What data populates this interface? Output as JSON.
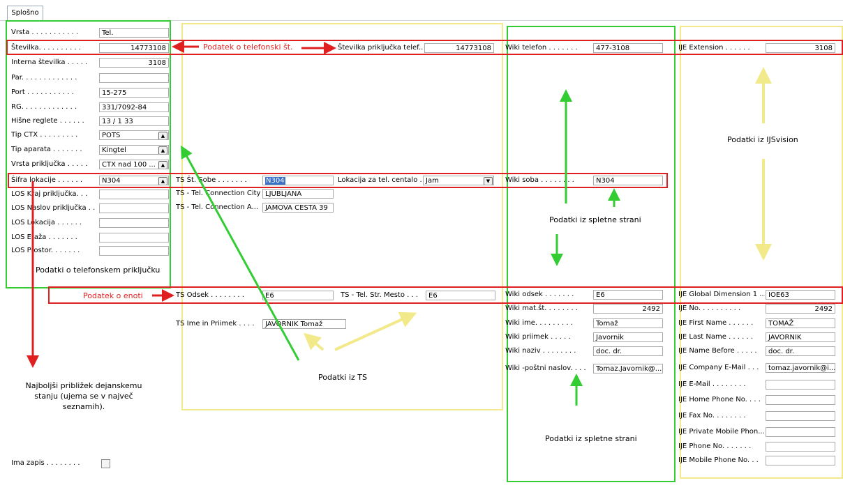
{
  "tabs": [
    {
      "label": "Splošno"
    }
  ],
  "col1": [
    {
      "label": "Vrsta . . . . . . . . . . .",
      "value": "Tel."
    },
    {
      "label": "Številka. . . . . . . . . .",
      "value": "14773108"
    },
    {
      "label": "Interna številka . . . . .",
      "value": "3108"
    },
    {
      "label": "Par. . . . . . . . . . . . .",
      "value": ""
    },
    {
      "label": "Port . . . . . . . . . . .",
      "value": "15-275"
    },
    {
      "label": "RG. . . . . . . . . . . . .",
      "value": "331/7092-84"
    },
    {
      "label": "Hišne reglete . . . . . .",
      "value": "13 / 1 33"
    },
    {
      "label": "Tip CTX . . . . . . . . .",
      "value": "POTS"
    },
    {
      "label": "Tip aparata . . . . . . .",
      "value": "Kingtel"
    },
    {
      "label": "Vrsta priključka . . . . .",
      "value": "CTX nad 100 ..."
    },
    {
      "label": "Šifra lokacije . . . . . .",
      "value": "N304"
    },
    {
      "label": "LOS Kraj priključka. . .",
      "value": ""
    },
    {
      "label": "LOS Naslov priključka . .",
      "value": ""
    },
    {
      "label": "LOS Lokacija . . . . . .",
      "value": ""
    },
    {
      "label": "LOS Etaža . . . . . . .",
      "value": ""
    },
    {
      "label": "LOS Prostor. . . . . . .",
      "value": ""
    }
  ],
  "ts": {
    "stevilka_label": "Številka priključka telef...",
    "stevilka_value": "14773108",
    "soba_label": "TS Št. Sobe . . . . . . .",
    "soba_value": "N304",
    "lokacija_label": "Lokacija za tel. centalo .",
    "lokacija_value": "Jam",
    "city_label": "TS - Tel. Connection City",
    "city_value": "LJUBLJANA",
    "addr_label": "TS - Tel. Connection A...",
    "addr_value": "JAMOVA CESTA 39",
    "odsek_label": "TS Odsek . . . . . . . .",
    "odsek_value": "E6",
    "mesto_label": "TS - Tel. Str. Mesto . . .",
    "mesto_value": "E6",
    "ime_label": "TS Ime in Priimek . . . .",
    "ime_value": "JAVORNIK Tomaž"
  },
  "wiki": [
    {
      "label": "Wiki telefon . . . . . . .",
      "value": "477-3108"
    },
    {
      "label": "Wiki soba . . . . . . . .",
      "value": "N304"
    },
    {
      "label": "Wiki odsek . . . . . . .",
      "value": "E6"
    },
    {
      "label": "Wiki mat.št. . . . . . . .",
      "value": "2492",
      "right": true
    },
    {
      "label": "Wiki ime. . . . . . . . .",
      "value": "Tomaž"
    },
    {
      "label": "Wiki priimek . . . . .",
      "value": "Javornik"
    },
    {
      "label": "Wiki naziv . . . . . . . .",
      "value": "doc. dr."
    },
    {
      "label": "Wiki -poštni naslov. . . .",
      "value": "Tomaz.Javornik@..."
    }
  ],
  "ijs": [
    {
      "label": "IJE Extension . . . . . .",
      "value": "3108",
      "right": true
    },
    {
      "label": "IJE Global Dimension 1 ...",
      "value": "IOE63"
    },
    {
      "label": "IJE No. . . . . . . . . .",
      "value": "2492",
      "right": true
    },
    {
      "label": "IJE First Name . . . . . .",
      "value": "TOMAŽ"
    },
    {
      "label": "IJE Last Name . . . . . .",
      "value": "JAVORNIK"
    },
    {
      "label": "IJE Name Before . . . . .",
      "value": "doc. dr."
    },
    {
      "label": "IJE Company E-Mail . . .",
      "value": "tomaz.javornik@i..."
    },
    {
      "label": "IJE E-Mail . . . . . . . .",
      "value": ""
    },
    {
      "label": "IJE Home Phone No. . . .",
      "value": ""
    },
    {
      "label": "IJE Fax No. . . . . . . .",
      "value": ""
    },
    {
      "label": "IJE Private Mobile Phon...",
      "value": ""
    },
    {
      "label": "IJE Phone No. . . . . . .",
      "value": ""
    },
    {
      "label": "IJE Mobile Phone No. . .",
      "value": ""
    }
  ],
  "ima_zapis_label": "Ima zapis . . . . . . . .",
  "annotations": {
    "podatek_tel": "Podatek o telefonski št.",
    "podatek_enoti": "Podatek o enoti",
    "podatki_prikljucku": "Podatki o telefonskem priključku",
    "podatki_ts": "Podatki iz TS",
    "spletne1": "Podatki iz spletne strani",
    "spletne2": "Podatki iz spletne strani",
    "ijsvision": "Podatki iz IJSvision",
    "najboljsi": "Najboljši približek dejanskemu stanju (ujema se v največ seznamih)."
  },
  "colors": {
    "red": "#e02020",
    "green": "#33cc33",
    "yellow": "#f2e98a",
    "selection": "#3a71c8"
  },
  "icons": {
    "dropdown": "dropdown-arrow-icon",
    "checkbox": "checkbox-icon"
  }
}
